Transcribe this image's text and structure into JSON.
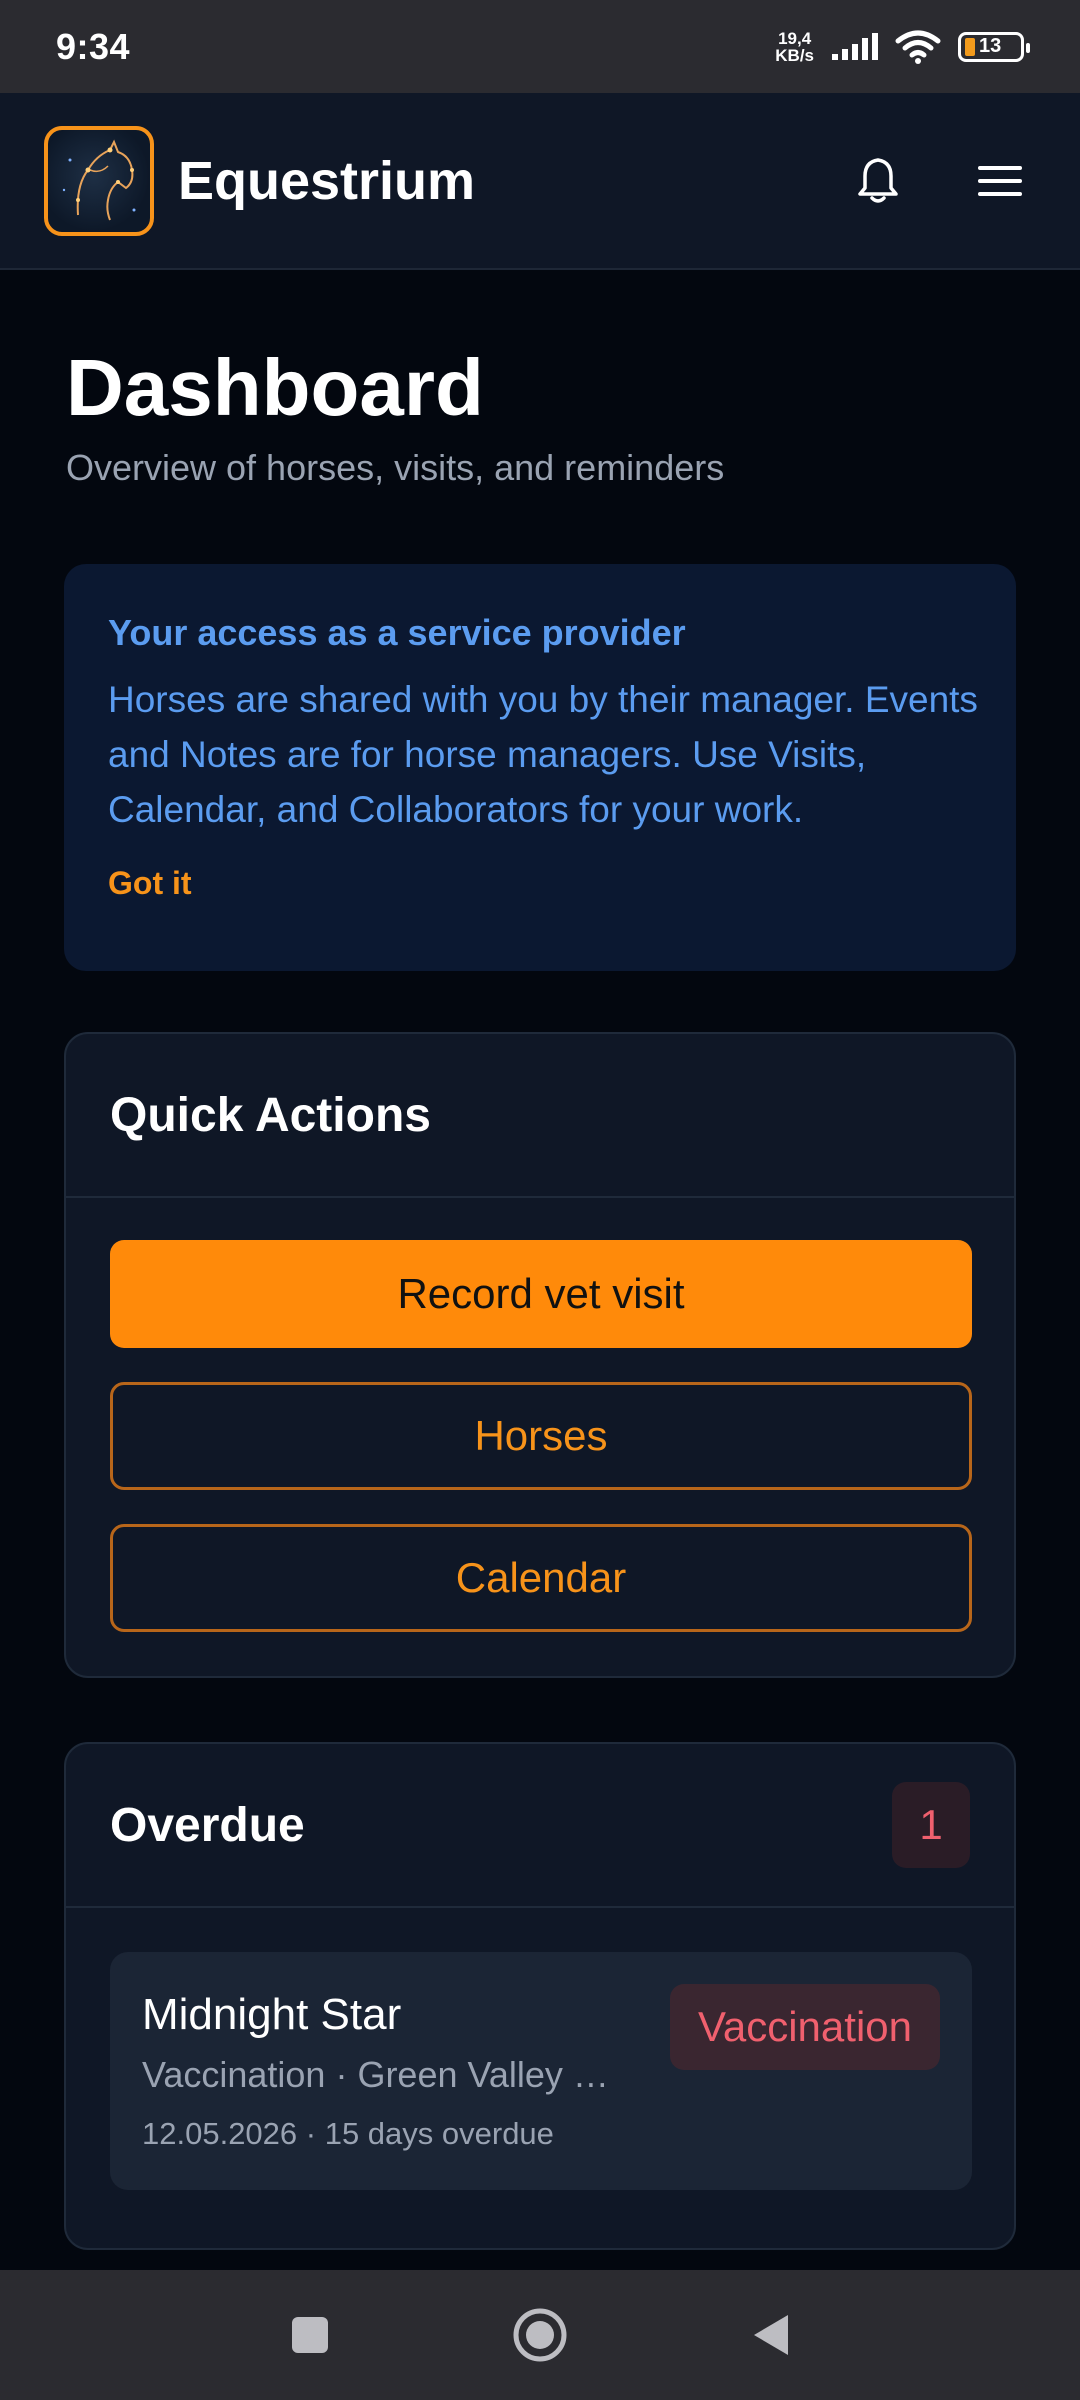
{
  "status": {
    "time": "9:34",
    "netspeed_value": "19,4",
    "netspeed_unit": "KB/s",
    "battery": "13"
  },
  "app": {
    "name": "Equestrium"
  },
  "page": {
    "title": "Dashboard",
    "subtitle": "Overview of horses, visits, and reminders"
  },
  "info": {
    "title": "Your access as a service provider",
    "body": "Horses are shared with you by their manager. Events and Notes are for horse managers. Use Visits, Calendar, and Collaborators for your work.",
    "dismiss": "Got it"
  },
  "quick_actions": {
    "title": "Quick Actions",
    "buttons": [
      "Record vet visit",
      "Horses",
      "Calendar"
    ]
  },
  "overdue": {
    "title": "Overdue",
    "count": "1",
    "items": [
      {
        "name": "Midnight Star",
        "meta": "Vaccination · Green Valley …",
        "date": "12.05.2026 · 15 days overdue",
        "badge": "Vaccination"
      }
    ]
  },
  "colors": {
    "accent": "#ff8a0a",
    "info": "#5b9cf0",
    "danger": "#f0606e",
    "background": "#03070f"
  },
  "icons": [
    "horse-logo-icon",
    "bell-icon",
    "menu-icon",
    "wifi-icon",
    "signal-icon",
    "nav-recents-icon",
    "nav-home-icon",
    "nav-back-icon"
  ]
}
